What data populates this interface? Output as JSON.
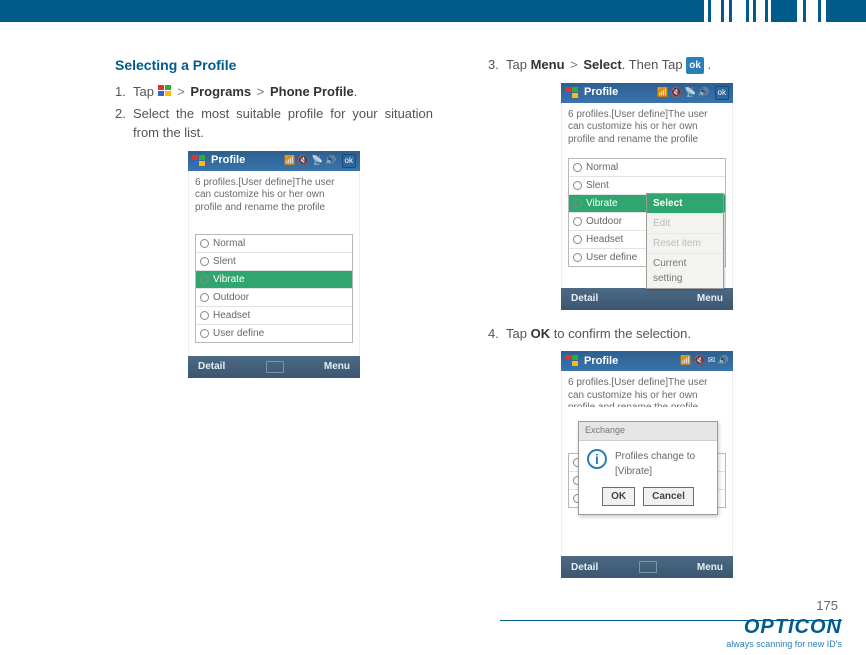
{
  "page_number": "175",
  "brand": {
    "logo": "OPTICON",
    "tagline": "always scanning for new ID's"
  },
  "left": {
    "heading": "Selecting a Profile",
    "step1": {
      "num": "1.",
      "t_tap": "Tap ",
      "t_programs": "Programs",
      "t_phoneprofile": "Phone Profile",
      "sep": ">",
      "period": "."
    },
    "step2": {
      "num": "2.",
      "text": "Select the most suitable profile for your situation from the list."
    }
  },
  "right": {
    "step3": {
      "num": "3.",
      "t_tap": "Tap ",
      "t_menu": "Menu",
      "sep": ">",
      "t_select": "Select",
      "t_then": ". Then Tap ",
      "ok_chip": "ok",
      "period": " ."
    },
    "step4": {
      "num": "4.",
      "t_tap": "Tap ",
      "t_ok": "OK",
      "t_rest": " to confirm the selection."
    }
  },
  "phones": {
    "title": "Profile",
    "hint": "6 profiles.[User define]The user can customize his or her own profile and rename the profile",
    "ok_btn": "ok",
    "items": [
      "Normal",
      "Slent",
      "Vibrate",
      "Outdoor",
      "Headset",
      "User define"
    ],
    "soft_left": "Detail",
    "soft_right": "Menu"
  },
  "ctx_menu": {
    "items": [
      {
        "label": "Select",
        "hl": true
      },
      {
        "label": "Edit",
        "dis": true
      },
      {
        "label": "Reset item",
        "dis": true
      },
      {
        "label": "Current setting"
      }
    ]
  },
  "dialog": {
    "title": "Exchange",
    "msg": "Profiles change to [Vibrate]",
    "ok": "OK",
    "cancel": "Cancel"
  }
}
